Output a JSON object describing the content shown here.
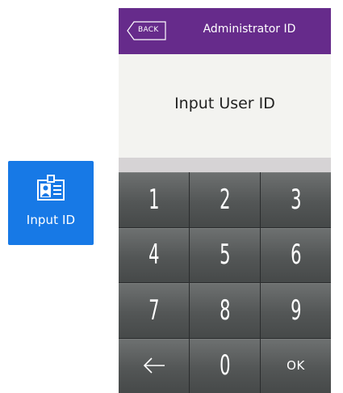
{
  "tile": {
    "label": "Input ID",
    "icon": "id-card-icon",
    "color": "#1779e6"
  },
  "header": {
    "back_label": "BACK",
    "title": "Administrator ID",
    "color": "#662b8b"
  },
  "content": {
    "prompt": "Input User ID"
  },
  "keypad": {
    "keys": [
      {
        "label": "1"
      },
      {
        "label": "2"
      },
      {
        "label": "3"
      },
      {
        "label": "4"
      },
      {
        "label": "5"
      },
      {
        "label": "6"
      },
      {
        "label": "7"
      },
      {
        "label": "8"
      },
      {
        "label": "9"
      },
      {
        "label": "",
        "icon": "arrow-left-icon"
      },
      {
        "label": "0"
      },
      {
        "label": "OK"
      }
    ]
  }
}
